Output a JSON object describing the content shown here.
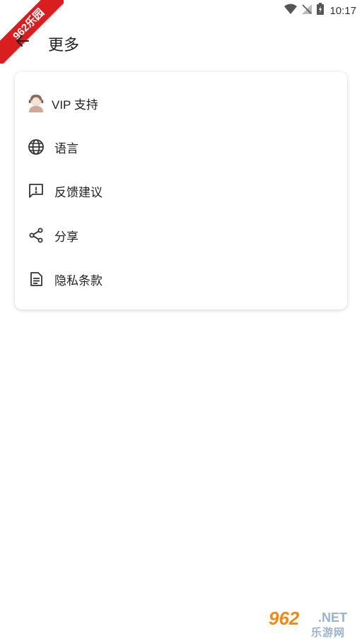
{
  "status_bar": {
    "time": "10:17"
  },
  "ribbon": {
    "text": "962乐园"
  },
  "header": {
    "title": "更多"
  },
  "menu": {
    "items": [
      {
        "label": "VIP 支持",
        "icon": "vip-support-avatar-icon"
      },
      {
        "label": "语言",
        "icon": "globe-icon"
      },
      {
        "label": "反馈建议",
        "icon": "feedback-icon"
      },
      {
        "label": "分享",
        "icon": "share-icon"
      },
      {
        "label": "隐私条款",
        "icon": "document-icon"
      }
    ]
  },
  "watermark": {
    "brand": "962",
    "suffix": ".NET",
    "sub": "乐游网"
  },
  "colors": {
    "ribbon": "#d81e1e",
    "watermark_orange": "#f08a17"
  }
}
